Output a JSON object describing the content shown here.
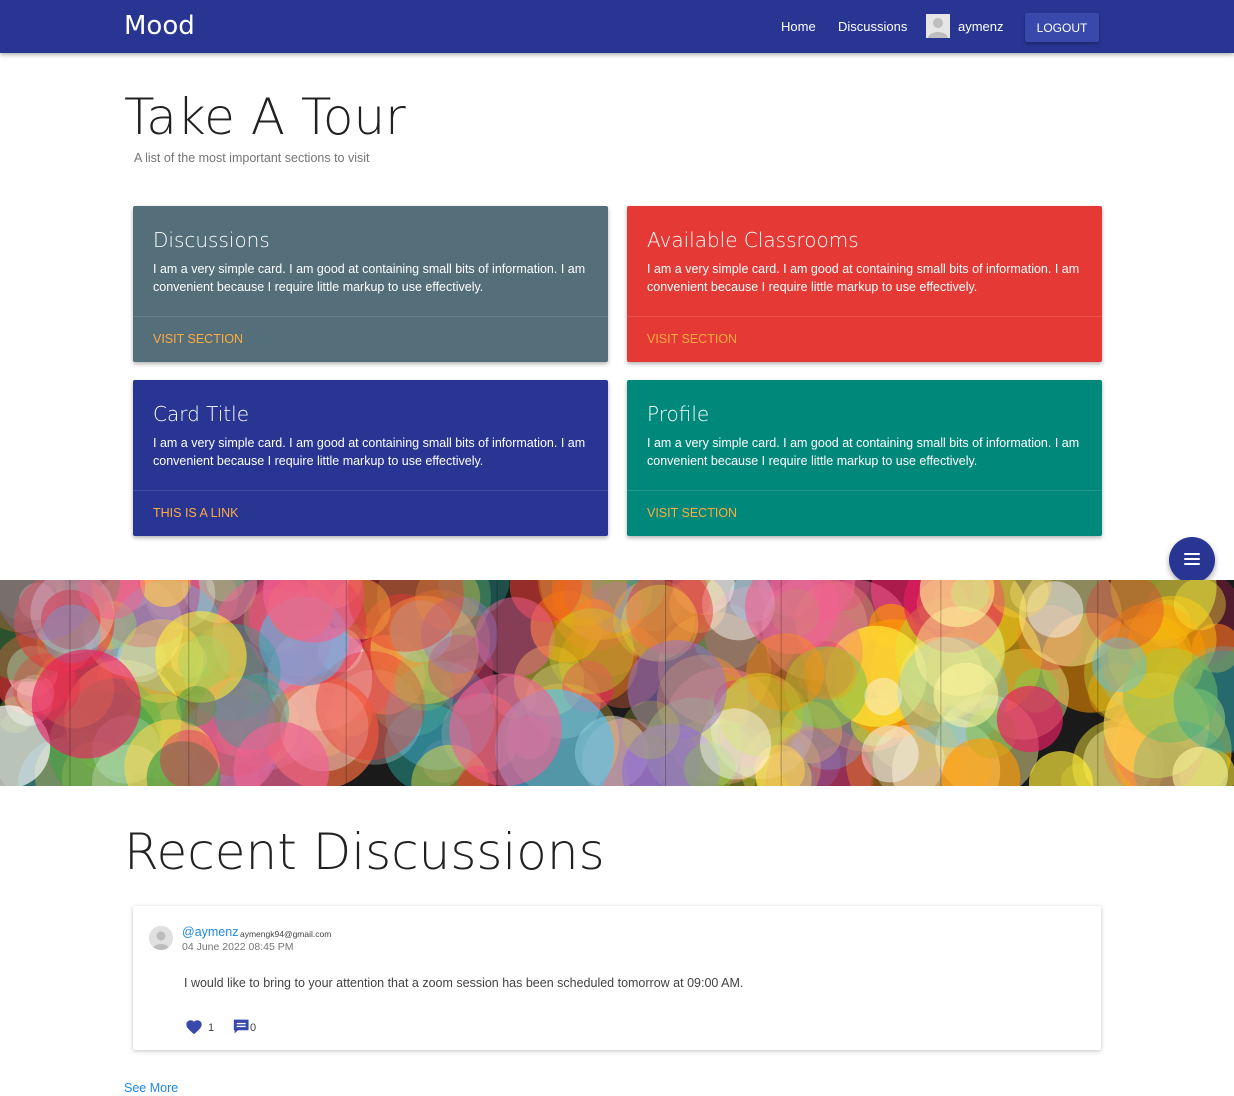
{
  "navbar": {
    "brand": "Mood",
    "links": [
      "Home",
      "Discussions"
    ],
    "username": "aymenz",
    "logout_label": "LOGOUT",
    "background": "#283593"
  },
  "tour": {
    "title": "Take A Tour",
    "subtitle": "A list of the most important sections to visit"
  },
  "cards": [
    {
      "title": "Discussions",
      "text": "I am a very simple card. I am good at containing small bits of information. I am convenient because I require little markup to use effectively.",
      "link": "VISIT SECTION",
      "color": "#546e7a"
    },
    {
      "title": "Available Classrooms",
      "text": "I am a very simple card. I am good at containing small bits of information. I am convenient because I require little markup to use effectively.",
      "link": "VISIT SECTION",
      "color": "#e53935"
    },
    {
      "title": "Card Title",
      "text": "I am a very simple card. I am good at containing small bits of information. I am convenient because I require little markup to use effectively.",
      "link": "THIS IS A LINK",
      "color": "#283593"
    },
    {
      "title": "Profile",
      "text": "I am a very simple card. I am good at containing small bits of information. I am convenient because I require little markup to use effectively.",
      "link": "VISIT SECTION",
      "color": "#00897b"
    }
  ],
  "fab": {
    "icon": "menu-icon",
    "color": "#283593"
  },
  "recent": {
    "title": "Recent Discussions",
    "post": {
      "username": "@aymenz",
      "email": "aymengk94@gmail.com",
      "date": "04 June 2022 08:45 PM",
      "body": "I would like to bring to your attention that a zoom session has been scheduled tomorrow at 09:00 AM.",
      "likes": "1",
      "comments": "0",
      "like_icon": "heart-icon",
      "comment_icon": "comment-icon"
    },
    "see_more": "See More"
  },
  "link_color": "#ffab40"
}
